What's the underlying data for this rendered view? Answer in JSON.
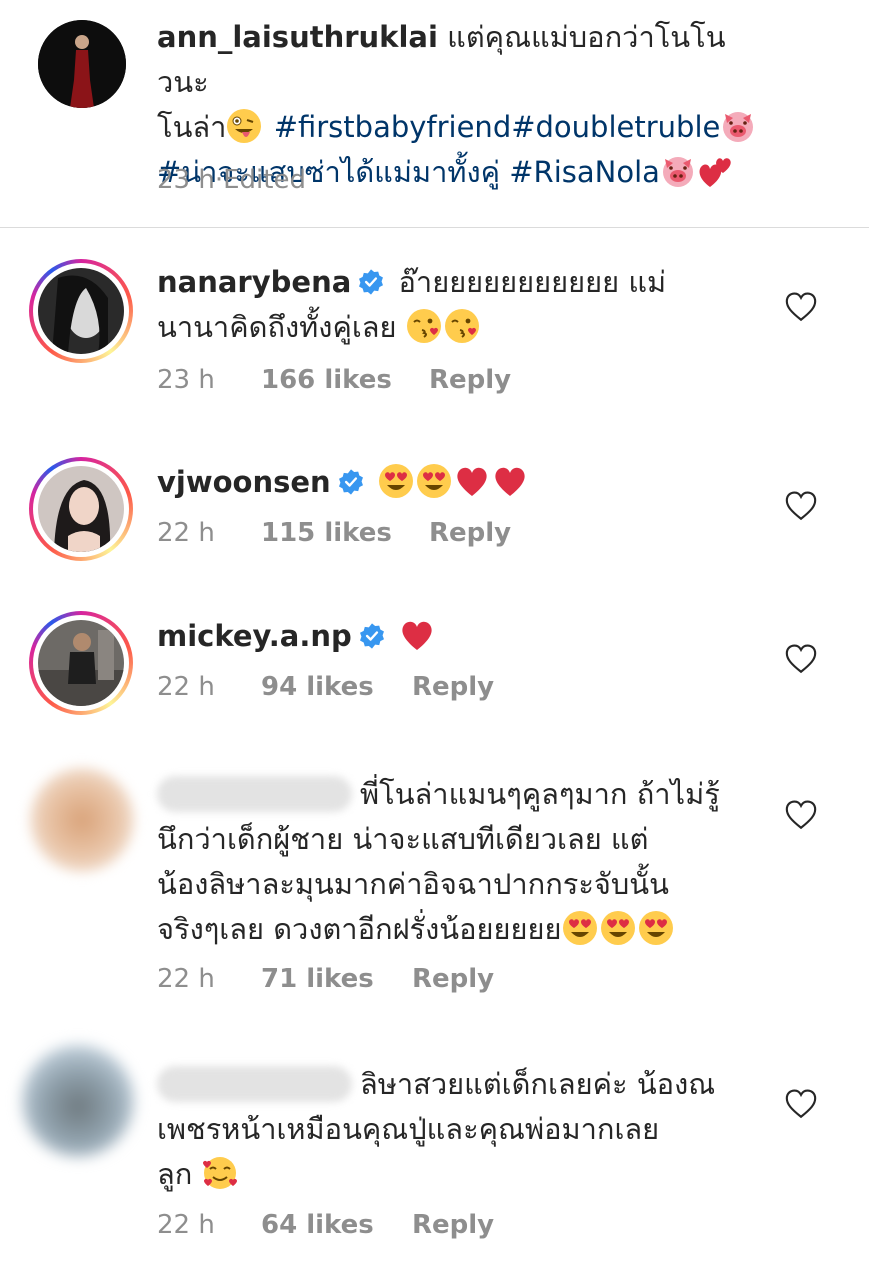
{
  "caption": {
    "username": "ann_laisuthruklai",
    "text_1": "แต่คุณแม่บอกว่าโนโนวนะ",
    "text_2": "โนล่า",
    "hashtags_1": "#firstbabyfriend#doubletruble",
    "hashtags_2": "#น่าจะแสบซ่าได้แม่มาทั้งคู่ #RisaNola",
    "time": "23 h",
    "separator": " · ",
    "edited": "Edited"
  },
  "comments": [
    {
      "username": "nanarybena",
      "verified": true,
      "text_1": "อ๊ายยยยยยยยยยย แม่",
      "text_2": "นานาคิดถึงทั้งคู่เลย",
      "time": "23 h",
      "likes": "166 likes",
      "reply": "Reply"
    },
    {
      "username": "vjwoonsen",
      "verified": true,
      "text_1": "",
      "time": "22 h",
      "likes": "115 likes",
      "reply": "Reply"
    },
    {
      "username": "mickey.a.np",
      "verified": true,
      "text_1": "",
      "time": "22 h",
      "likes": "94 likes",
      "reply": "Reply"
    },
    {
      "username": "",
      "verified": false,
      "text_1": "พี่โนล่าแมนๆคูลๆมาก ถ้าไม่รู้",
      "text_2": "นึกว่าเด็กผู้ชาย น่าจะแสบทีเดียวเลย แต่",
      "text_3": "น้องลิษาละมุนมากค่าอิจฉาปากกระจับนั้น",
      "text_4": "จริงๆเลย ดวงตาอีกฝรั่งน้อยยยยย",
      "time": "22 h",
      "likes": "71 likes",
      "reply": "Reply"
    },
    {
      "username": "",
      "verified": false,
      "text_1": "ลิษาสวยแต่เด็กเลยค่ะ น้องณ",
      "text_2": "เพชรหน้าเหมือนคุณปู่และคุณพ่อมากเลย",
      "text_3": "ลูก",
      "time": "22 h",
      "likes": "64 likes",
      "reply": "Reply"
    }
  ],
  "icons": {
    "heart": "heart-outline-icon",
    "verified": "verified-badge-icon",
    "emoji": [
      "crazy-face",
      "pig-face",
      "two-hearts",
      "kissing-heart",
      "heart-eyes",
      "red-heart",
      "smiling-hearts"
    ]
  },
  "colors": {
    "hashtag": "#003569",
    "meta": "#8e8e8e",
    "verified": "#3897f0",
    "heart_red": "#ed4956"
  }
}
